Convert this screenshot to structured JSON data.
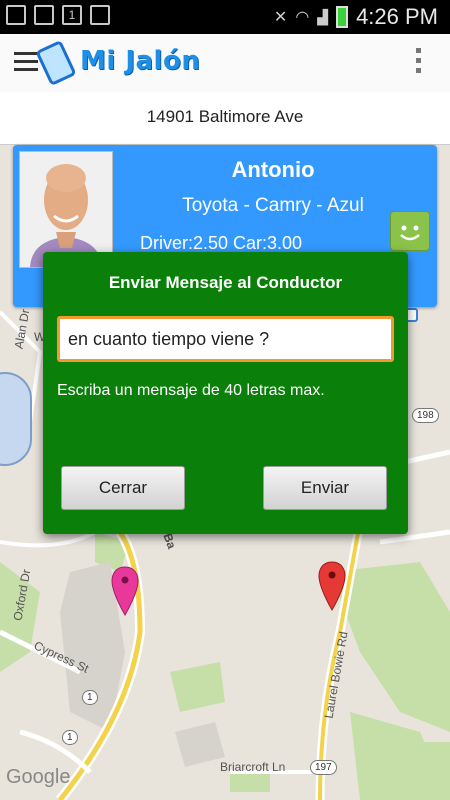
{
  "status_bar": {
    "time": "4:26 PM",
    "notification_badge": "1"
  },
  "app": {
    "title": "Mi Jalón"
  },
  "address": "14901 Baltimore Ave",
  "driver": {
    "name": "Antonio",
    "vehicle": "Toyota - Camry - Azul",
    "rating": "Driver:2.50 Car:3.00"
  },
  "dialog": {
    "title": "Enviar Mensaje al Conductor",
    "message_value": "en cuanto tiempo viene ?",
    "hint": "Escriba un mensaje de 40 letras max.",
    "close_label": "Cerrar",
    "send_label": "Enviar"
  },
  "map": {
    "attribution": "Google",
    "road_labels": {
      "alan_dr": "Alan Dr",
      "oxford_dr": "Oxford Dr",
      "cypress_st": "Cypress St",
      "laurel_bowie": "Laurel Bowie Rd",
      "briarcroft": "Briarcroft Ln",
      "baltimore_partial": "Ba",
      "w_partial": "W"
    },
    "shields": {
      "r198": "198",
      "r1a": "1",
      "r1b": "1",
      "r197": "197"
    }
  },
  "colors": {
    "card": "#3399ff",
    "dialog": "#0a800a",
    "input_border": "#f29a2e",
    "accent": "#1f8fe5"
  }
}
